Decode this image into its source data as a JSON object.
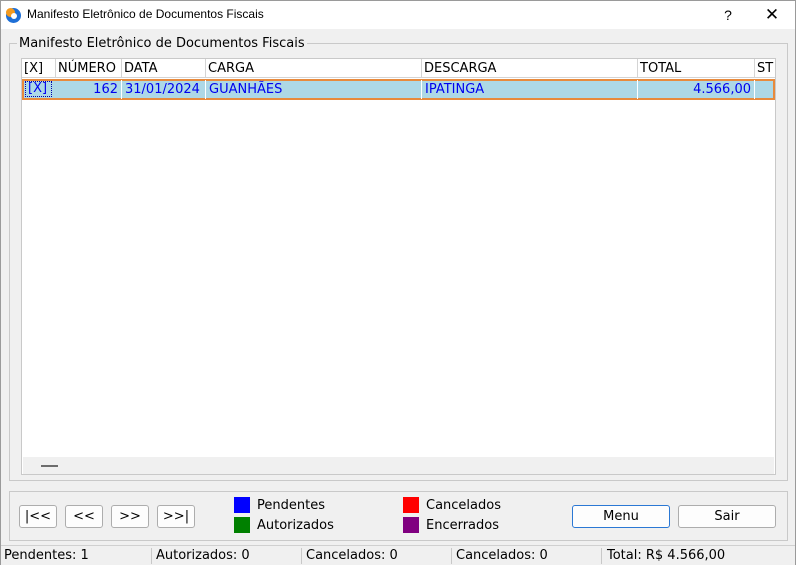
{
  "window": {
    "title": "Manifesto Eletrônico de Documentos Fiscais",
    "help_label": "?",
    "close_label": "✕"
  },
  "group": {
    "title": "Manifesto Eletrônico de Documentos Fiscais"
  },
  "grid": {
    "columns": [
      "[X]",
      "NÚMERO",
      "DATA",
      "CARGA",
      "DESCARGA",
      "TOTAL",
      "ST"
    ],
    "rows": [
      {
        "check": "[X]",
        "numero": "162",
        "data": "31/01/2024",
        "carga": "GUANHÃES",
        "descarga": "IPATINGA",
        "total": "4.566,00",
        "st": ""
      }
    ]
  },
  "navigation": {
    "first": "|<<",
    "prev": "<<",
    "next": ">>",
    "last": ">>|"
  },
  "legend": {
    "pendentes": {
      "label": "Pendentes",
      "color": "#0000ff"
    },
    "autorizados": {
      "label": "Autorizados",
      "color": "#008000"
    },
    "cancelados": {
      "label": "Cancelados",
      "color": "#ff0000"
    },
    "encerrados": {
      "label": "Encerrados",
      "color": "#800080"
    }
  },
  "actions": {
    "menu": "Menu",
    "sair": "Sair"
  },
  "status": {
    "pendentes": "Pendentes: 1",
    "autorizados": "Autorizados: 0",
    "cancelados_1": "Cancelados: 0",
    "cancelados_2": "Cancelados: 0",
    "total": "Total: R$ 4.566,00"
  }
}
